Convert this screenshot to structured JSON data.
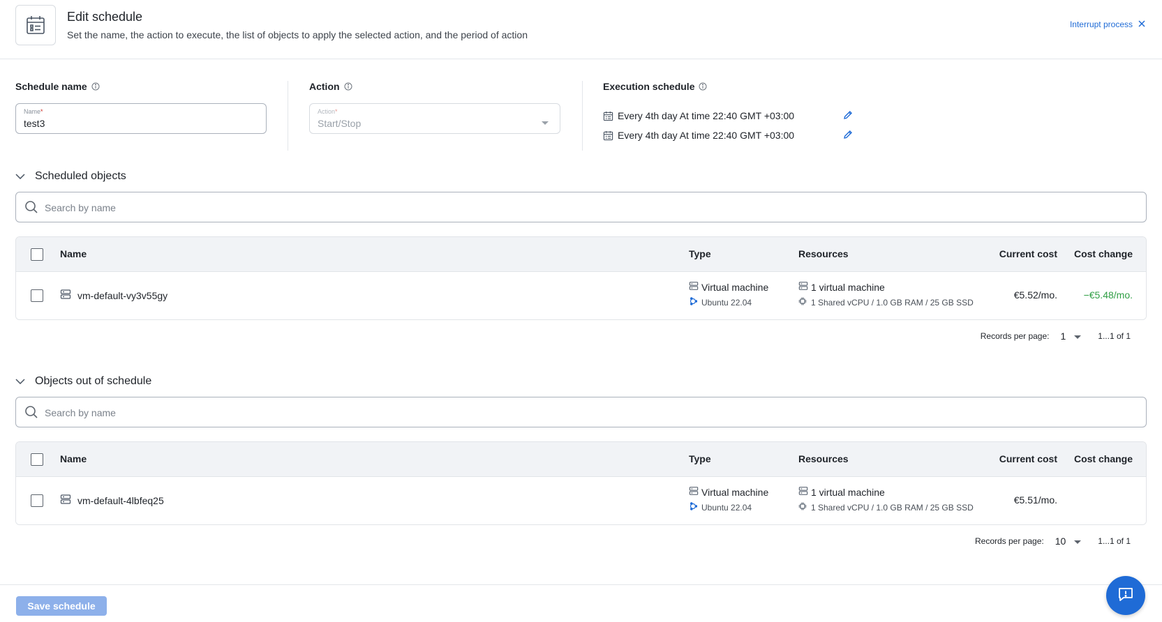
{
  "header": {
    "title": "Edit schedule",
    "subtitle": "Set the name, the action to execute, the list of objects to apply the selected action, and the period of action",
    "interrupt_label": "Interrupt process"
  },
  "schedule_name": {
    "section_label": "Schedule name",
    "field_label": "Name",
    "value": "test3"
  },
  "action": {
    "section_label": "Action",
    "field_label": "Action",
    "value": "Start/Stop"
  },
  "execution": {
    "section_label": "Execution schedule",
    "items": [
      "Every 4th day At time 22:40 GMT +03:00",
      "Every 4th day At time 22:40 GMT +03:00"
    ]
  },
  "scheduled": {
    "title": "Scheduled objects",
    "search_placeholder": "Search by name",
    "columns": {
      "name": "Name",
      "type": "Type",
      "resources": "Resources",
      "cost": "Current cost",
      "change": "Cost change"
    },
    "rows": [
      {
        "name": "vm-default-vy3v55gy",
        "type": "Virtual machine",
        "os": "Ubuntu 22.04",
        "resources": "1 virtual machine",
        "resources_detail": "1 Shared vCPU / 1.0 GB RAM / 25 GB SSD",
        "cost": "€5.52/mo.",
        "change": "−€5.48/mo."
      }
    ],
    "pager": {
      "label": "Records per page:",
      "value": "1",
      "range": "1...1 of 1"
    }
  },
  "unscheduled": {
    "title": "Objects out of schedule",
    "search_placeholder": "Search by name",
    "columns": {
      "name": "Name",
      "type": "Type",
      "resources": "Resources",
      "cost": "Current cost",
      "change": "Cost change"
    },
    "rows": [
      {
        "name": "vm-default-4lbfeq25",
        "type": "Virtual machine",
        "os": "Ubuntu 22.04",
        "resources": "1 virtual machine",
        "resources_detail": "1 Shared vCPU / 1.0 GB RAM / 25 GB SSD",
        "cost": "€5.51/mo.",
        "change": ""
      }
    ],
    "pager": {
      "label": "Records per page:",
      "value": "10",
      "range": "1...1 of 1"
    }
  },
  "footer": {
    "save_label": "Save schedule"
  },
  "colors": {
    "accent": "#1f6bd6",
    "positive": "#2f9e44",
    "save_disabled": "#8db0ea"
  }
}
